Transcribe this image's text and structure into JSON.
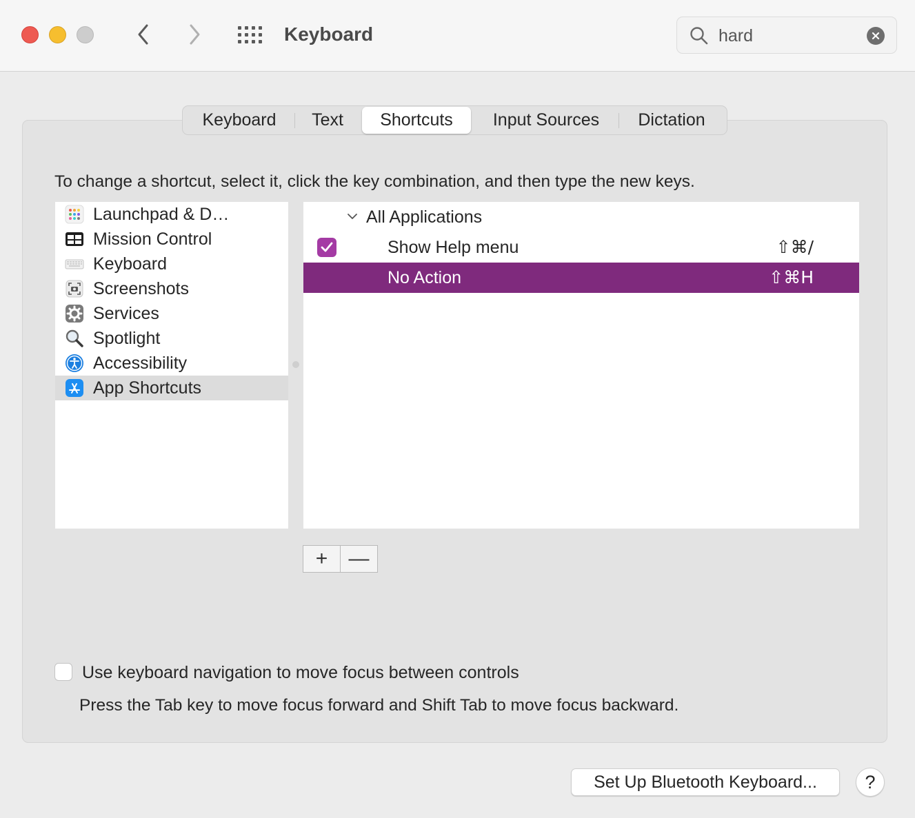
{
  "window": {
    "title": "Keyboard",
    "search": {
      "value": "hard"
    }
  },
  "tabs": [
    {
      "label": "Keyboard"
    },
    {
      "label": "Text"
    },
    {
      "label": "Shortcuts",
      "active": true
    },
    {
      "label": "Input Sources"
    },
    {
      "label": "Dictation"
    }
  ],
  "instructions": "To change a shortcut, select it, click the key combination, and then type the new keys.",
  "categories": [
    {
      "label": "Launchpad & D…",
      "icon": "launchpad-icon"
    },
    {
      "label": "Mission Control",
      "icon": "mission-control-icon"
    },
    {
      "label": "Keyboard",
      "icon": "keyboard-icon"
    },
    {
      "label": "Screenshots",
      "icon": "screenshots-icon"
    },
    {
      "label": "Services",
      "icon": "services-gear-icon"
    },
    {
      "label": "Spotlight",
      "icon": "spotlight-magnifier-icon"
    },
    {
      "label": "Accessibility",
      "icon": "accessibility-icon"
    },
    {
      "label": "App Shortcuts",
      "icon": "app-store-icon",
      "selected": true
    }
  ],
  "shortcuts": {
    "group": "All Applications",
    "rows": [
      {
        "label": "Show Help menu",
        "keys": "⇧⌘/",
        "checked": true
      },
      {
        "label": "No Action",
        "keys": "⇧⌘H",
        "selected": true
      }
    ]
  },
  "buttons": {
    "add": "+",
    "remove": "—",
    "bluetooth": "Set Up Bluetooth Keyboard...",
    "help": "?"
  },
  "keyboard_navigation": {
    "label": "Use keyboard navigation to move focus between controls",
    "checked": false,
    "help": "Press the Tab key to move focus forward and Shift Tab to move focus backward."
  },
  "colors": {
    "selection": "#7f2a7d",
    "checkbox_accent": "#a43ba4",
    "close": "#ee5a52",
    "minimize": "#f6be2f"
  }
}
